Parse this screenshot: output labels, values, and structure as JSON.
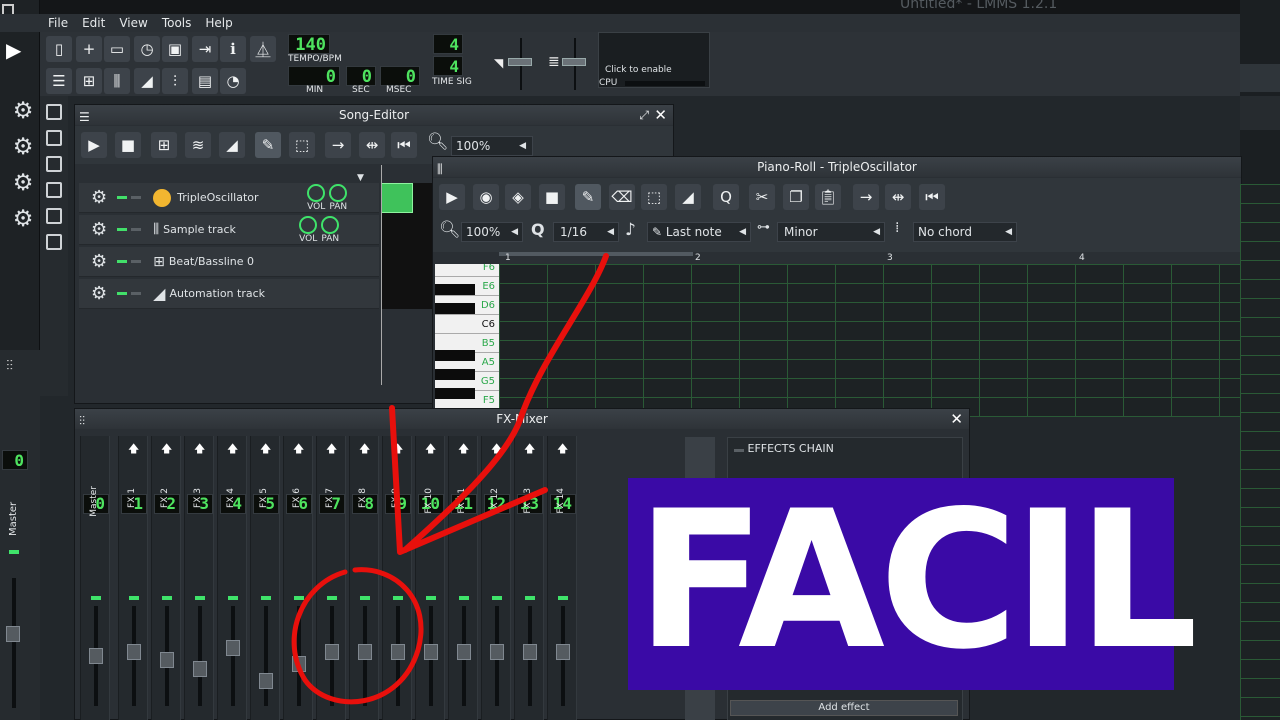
{
  "window_title": "Untitled* - LMMS 1.2.1",
  "menu": [
    "File",
    "Edit",
    "View",
    "Tools",
    "Help"
  ],
  "toolbar": {
    "tempo_value": "140",
    "tempo_label": "TEMPO/BPM",
    "min_value": "0",
    "sec_value": "0",
    "msec_value": "0",
    "min_label": "MIN",
    "sec_label": "SEC",
    "msec_label": "MSEC",
    "timesig_top": "4",
    "timesig_bottom": "4",
    "timesig_label": "TIME SIG",
    "cpu_click": "Click to enable",
    "cpu_label": "CPU"
  },
  "song_editor": {
    "title": "Song-Editor",
    "zoom": "100%",
    "tracks": [
      {
        "name": "TripleOscillator",
        "vol": "VOL",
        "pan": "PAN",
        "icon": "triple-osc-icon"
      },
      {
        "name": "Sample track",
        "vol": "VOL",
        "pan": "PAN",
        "icon": "waveform-icon"
      },
      {
        "name": "Beat/Bassline 0",
        "icon": "grid-icon"
      },
      {
        "name": "Automation track",
        "icon": "ramp-icon"
      }
    ]
  },
  "piano_roll": {
    "title": "Piano-Roll - TripleOscillator",
    "zoom": "100%",
    "quantize": "1/16",
    "note_len": "Last note",
    "scale": "Minor",
    "chord": "No chord",
    "bars": [
      "1",
      "2",
      "3",
      "4"
    ],
    "keys": [
      "F6",
      "E6",
      "D6",
      "C6",
      "B5",
      "A5",
      "G5",
      "F5"
    ]
  },
  "mixer": {
    "title": "FX-Mixer",
    "master_label": "Master",
    "master_num": "0",
    "channels": [
      {
        "num": "1",
        "name": "FX 1",
        "level": 0.55
      },
      {
        "num": "2",
        "name": "FX 2",
        "level": 0.45
      },
      {
        "num": "3",
        "name": "FX 3",
        "level": 0.35
      },
      {
        "num": "4",
        "name": "FX 4",
        "level": 0.6
      },
      {
        "num": "5",
        "name": "FX 5",
        "level": 0.2
      },
      {
        "num": "6",
        "name": "FX 6",
        "level": 0.4
      },
      {
        "num": "7",
        "name": "FX 7",
        "level": 0.55
      },
      {
        "num": "8",
        "name": "FX 8",
        "level": 0.55
      },
      {
        "num": "9",
        "name": "FX 9",
        "level": 0.55
      },
      {
        "num": "10",
        "name": "FX 10",
        "level": 0.55
      },
      {
        "num": "11",
        "name": "FX 11",
        "level": 0.55
      },
      {
        "num": "12",
        "name": "FX 12",
        "level": 0.55
      },
      {
        "num": "13",
        "name": "FX 13",
        "level": 0.55
      },
      {
        "num": "14",
        "name": "FX 14",
        "level": 0.55
      }
    ],
    "effects_chain": "EFFECTS CHAIN",
    "add_effect": "Add effect"
  },
  "side_master": {
    "label": "Master",
    "num": "0"
  },
  "overlay": {
    "text": "FACIL",
    "bg": "#3a0aa6",
    "fg": "#ffffff",
    "annotation_color": "#e8100c"
  }
}
